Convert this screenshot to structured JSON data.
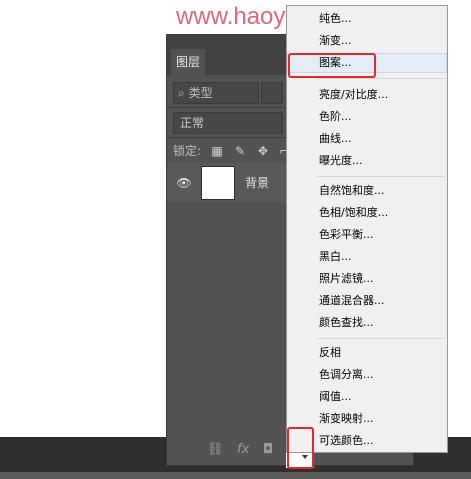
{
  "watermark": "www.haoyidianshejj.com",
  "panel": {
    "tab_label": "图层",
    "filter_placeholder": "类型",
    "filter_icon": "search-icon",
    "blend_mode": "正常",
    "lock_label": "锁定:",
    "lock_icons": [
      "checkerboard-icon",
      "brush-icon",
      "move-icon",
      "crop-icon"
    ],
    "layer": {
      "name": "背景",
      "visibility_icon": "eye-icon"
    },
    "footer_icons": [
      "link-icon",
      "fx-icon",
      "mask-icon"
    ]
  },
  "menu": {
    "groups": [
      [
        "纯色...",
        "渐变...",
        "图案..."
      ],
      [
        "亮度/对比度...",
        "色阶...",
        "曲线...",
        "曝光度..."
      ],
      [
        "自然饱和度...",
        "色相/饱和度...",
        "色彩平衡...",
        "黑白...",
        "照片滤镜...",
        "通道混合器...",
        "颜色查找..."
      ],
      [
        "反相",
        "色调分离...",
        "阈值...",
        "渐变映射...",
        "可选颜色..."
      ]
    ],
    "highlighted": "图案..."
  },
  "colors": {
    "watermark": "#e06878",
    "panel_bg": "#535353",
    "menu_bg": "#f0f0f0",
    "annotation_red": "#e02a2a"
  }
}
